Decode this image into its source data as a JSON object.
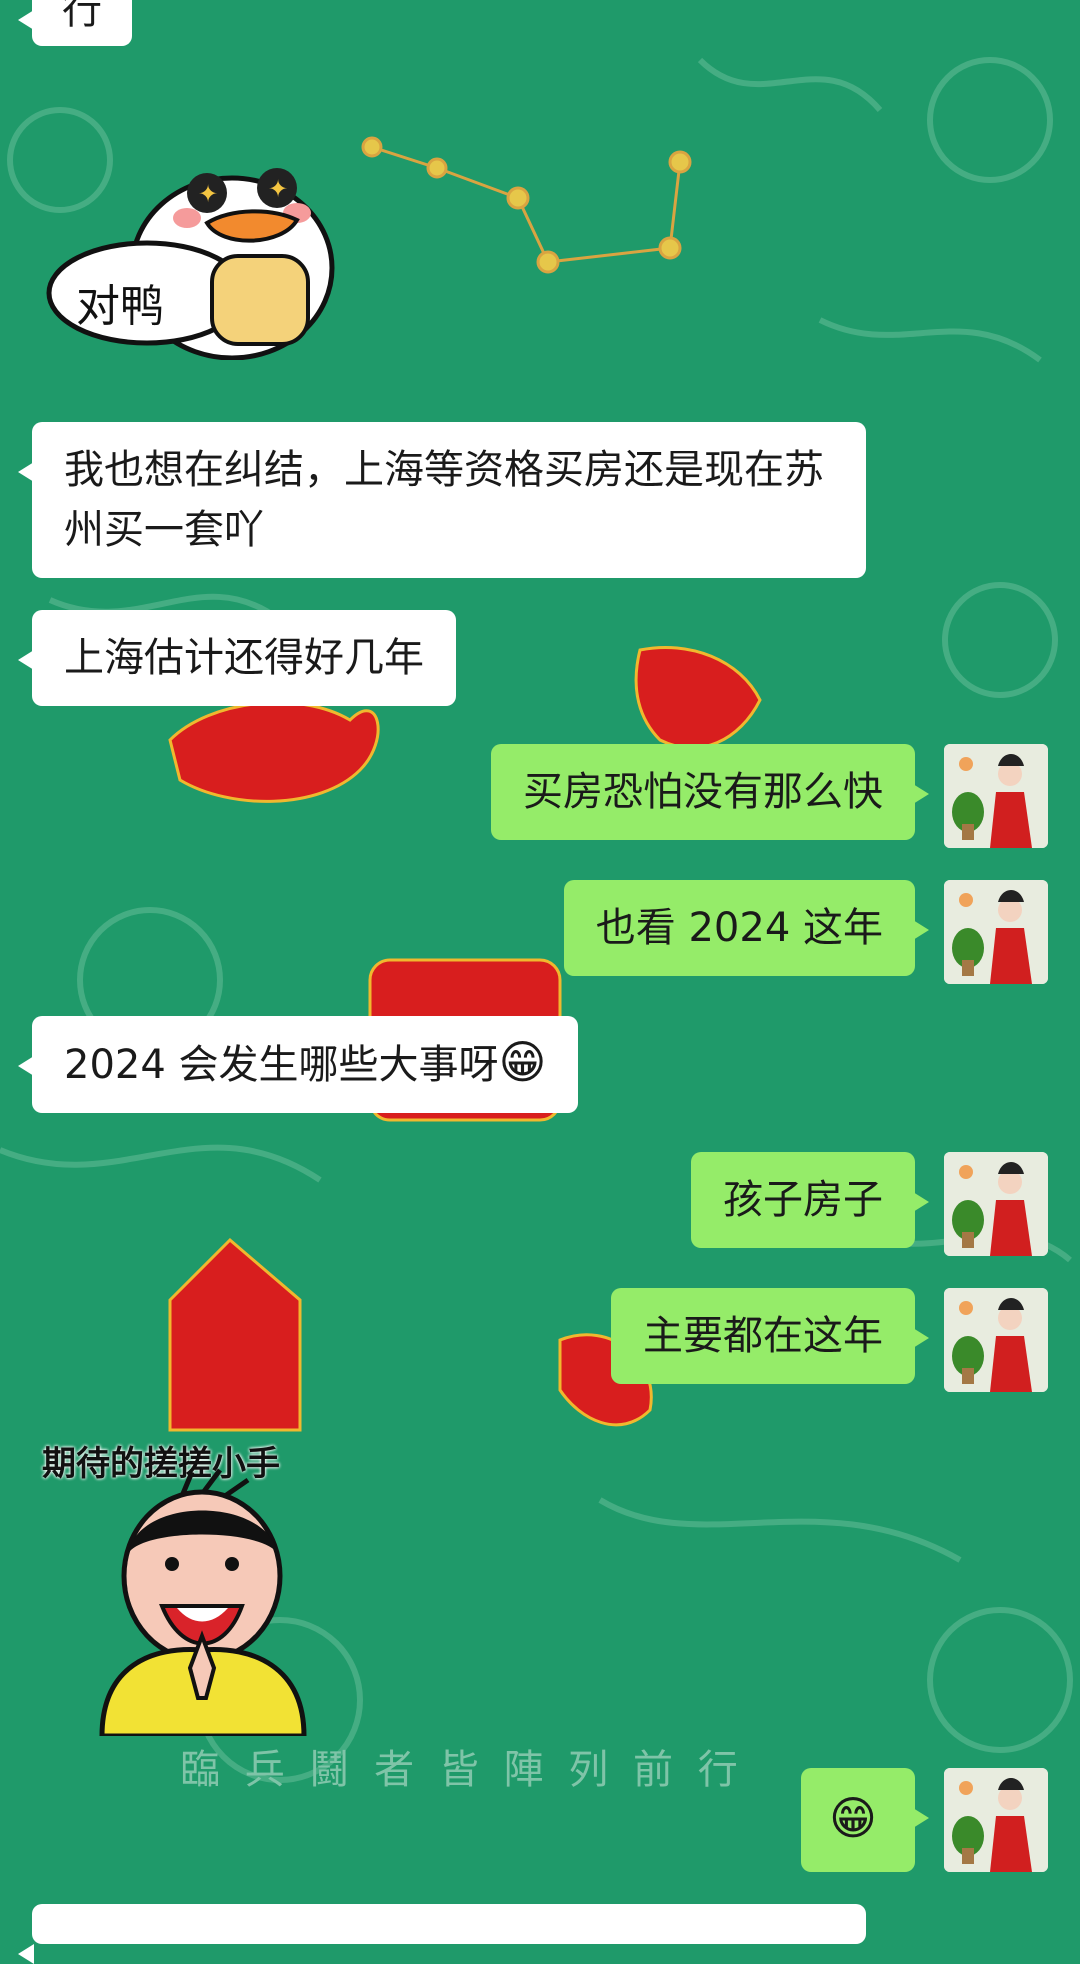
{
  "colors": {
    "background": "#1f9a6a",
    "incoming_bubble": "#ffffff",
    "outgoing_bubble": "#95ec69",
    "poster_red": "#d81e1e",
    "poster_faded_text": "#7fc4a8"
  },
  "background_poster": {
    "bottom_caption": "臨 兵 鬪 者 皆 陣 列 前 行"
  },
  "messages": [
    {
      "side": "in",
      "kind": "text",
      "text": "行"
    },
    {
      "side": "in",
      "kind": "sticker",
      "sticker_text": "对鸭",
      "sticker_name": "duck-sticker"
    },
    {
      "side": "in",
      "kind": "text",
      "text": "我也想在纠结，上海等资格买房还是现在苏州买一套吖"
    },
    {
      "side": "in",
      "kind": "text",
      "text": "上海估计还得好几年"
    },
    {
      "side": "out",
      "kind": "text",
      "text": "买房恐怕没有那么快"
    },
    {
      "side": "out",
      "kind": "text",
      "text": "也看 2024 这年"
    },
    {
      "side": "in",
      "kind": "text",
      "text": "2024 会发生哪些大事呀",
      "emoji": "😁"
    },
    {
      "side": "out",
      "kind": "text",
      "text": "孩子房子"
    },
    {
      "side": "out",
      "kind": "text",
      "text": "主要都在这年"
    },
    {
      "side": "in",
      "kind": "sticker",
      "sticker_text": "期待的搓搓小手",
      "sticker_name": "rubbing-hands-sticker"
    },
    {
      "side": "out",
      "kind": "emoji",
      "emoji": "😁"
    }
  ]
}
